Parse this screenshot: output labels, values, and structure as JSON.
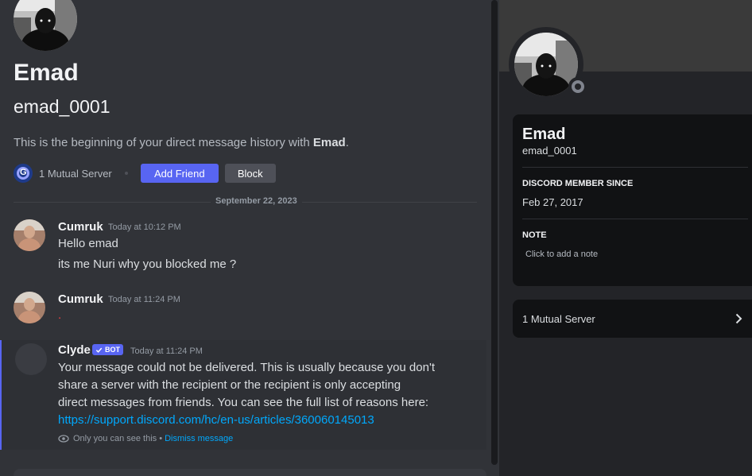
{
  "header": {
    "display_name": "Emad",
    "username": "emad_0001",
    "intro_prefix": "This is the beginning of your direct message history with ",
    "intro_name": "Emad",
    "intro_suffix": ".",
    "mutual_servers": "1 Mutual Server",
    "add_friend_label": "Add Friend",
    "block_label": "Block"
  },
  "date_divider": "September 22, 2023",
  "messages": [
    {
      "author": "Cumruk",
      "timestamp": "Today at 10:12 PM",
      "lines": [
        "Hello emad",
        "its me Nuri why you blocked me ?"
      ]
    },
    {
      "author": "Cumruk",
      "timestamp": "Today at 11:24 PM",
      "lines": [
        "."
      ]
    }
  ],
  "clyde": {
    "author": "Clyde",
    "bot_tag": "BOT",
    "timestamp": "Today at 11:24 PM",
    "lines": [
      "Your message could not be delivered. This is usually because you don't",
      "share a server with the recipient or the recipient is only accepting",
      "direct messages from friends. You can see the full list of reasons here:"
    ],
    "link": "https://support.discord.com/hc/en-us/articles/360060145013",
    "ephemeral_note": "Only you can see this •",
    "dismiss_label": "Dismiss message"
  },
  "profile": {
    "display_name": "Emad",
    "username": "emad_0001",
    "member_since_title": "DISCORD MEMBER SINCE",
    "member_since": "Feb 27, 2017",
    "note_title": "NOTE",
    "note_placeholder": "Click to add a note",
    "mutual_servers": "1 Mutual Server",
    "status": "offline"
  },
  "colors": {
    "accent": "#5865f2",
    "link": "#00a8fc",
    "background": "#313338",
    "panel": "#232428",
    "card": "#111214"
  },
  "icons": [
    "avatar-silhouette",
    "server-icon",
    "eye-icon",
    "chevron-right-icon",
    "status-offline-icon",
    "verified-check-icon"
  ]
}
